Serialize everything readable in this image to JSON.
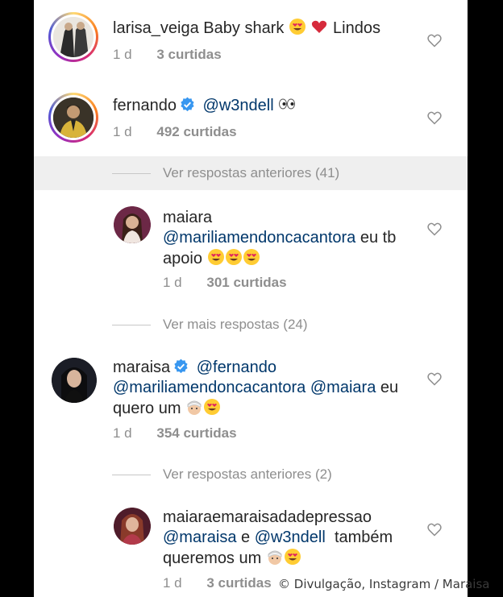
{
  "comments": [
    {
      "username": "larisa_veiga",
      "body": "Baby shark",
      "body_after": "Lindos",
      "time": "1 d",
      "likes": "3 curtidas"
    },
    {
      "username": "fernando",
      "mention": "@w3ndell",
      "time": "1 d",
      "likes": "492 curtidas"
    }
  ],
  "view_previous_1": "Ver respostas anteriores (41)",
  "reply_maiara": {
    "username": "maiara",
    "mention": "@mariliamendoncacantora",
    "body": "eu tb",
    "body_line2": "apoio",
    "time": "1 d",
    "likes": "301 curtidas"
  },
  "view_more": "Ver mais respostas (24)",
  "comment_maraisa": {
    "username": "maraisa",
    "mention1": "@fernando",
    "mention2": "@mariliamendoncacantora",
    "mention3": "@maiara",
    "body": "eu",
    "body_line3": "quero um",
    "time": "1 d",
    "likes": "354 curtidas"
  },
  "view_previous_2": "Ver respostas anteriores (2)",
  "reply_depressao": {
    "username": "maiaraemaraisadadepressao",
    "mention1": "@maraisa",
    "conj": "e",
    "mention2": "@w3ndell",
    "body": "também",
    "body_line3": "queremos um",
    "time": "1 d",
    "likes": "3 curtidas"
  },
  "watermark": "© Divulgação, Instagram / Maraisa",
  "colors": {
    "link": "#00376b",
    "meta": "#8e8e8e",
    "verified": "#3897f0",
    "heart_red": "#d62b3c"
  }
}
